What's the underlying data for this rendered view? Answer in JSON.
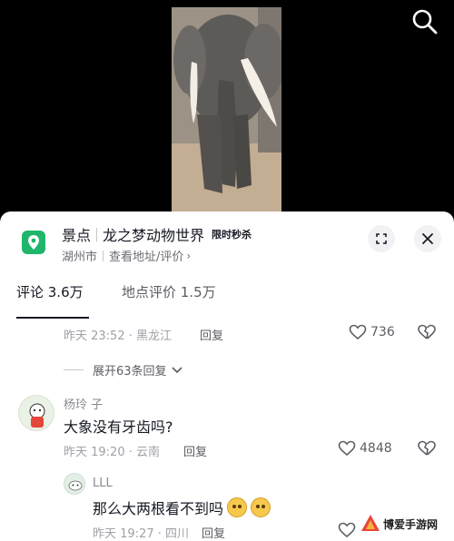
{
  "poi": {
    "category": "景点",
    "name": "龙之梦动物世界",
    "badge": "限时秒杀",
    "city": "湖州市",
    "address_link": "查看地址/评价",
    "icon": "map-pin-icon",
    "icon_color": "#1fb66b"
  },
  "tabs": {
    "comments": "评论 3.6万",
    "reviews": "地点评价 1.5万"
  },
  "comments": [
    {
      "meta": "昨天 23:52 · 黑龙江",
      "reply_label": "回复",
      "likes": "736"
    },
    {
      "author": "杨玲 子",
      "text": "大象没有牙齿吗?",
      "meta": "昨天 19:20 · 云南",
      "reply_label": "回复",
      "likes": "4848",
      "replies": [
        {
          "author": "LLL",
          "text": "那么大两根看不到吗",
          "emojis": [
            "sweat-smile-emoji",
            "sweat-smile-emoji"
          ],
          "meta": "昨天 19:27 · 四川",
          "reply_label": "回复"
        }
      ]
    }
  ],
  "expand_replies": "展开63条回复",
  "watermark": {
    "text": "博爱手游网"
  },
  "colors": {
    "text_primary": "#161823",
    "text_secondary": "#5c5d63",
    "text_meta": "#a0a1a7",
    "accent_green": "#1fb66b"
  }
}
